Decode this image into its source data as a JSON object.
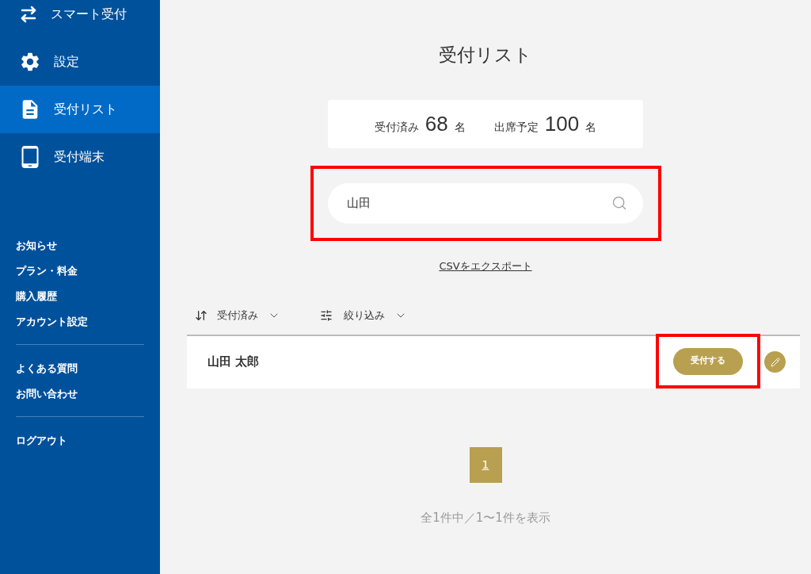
{
  "sidebar": {
    "nav_items": [
      {
        "label": "スマート受付",
        "selected": false
      },
      {
        "label": "設定",
        "selected": false
      },
      {
        "label": "受付リスト",
        "selected": true
      },
      {
        "label": "受付端末",
        "selected": false
      }
    ],
    "link_groups": [
      [
        "お知らせ",
        "プラン・料金",
        "購入履歴",
        "アカウント設定"
      ],
      [
        "よくある質問",
        "お問い合わせ"
      ],
      [
        "ログアウト"
      ]
    ]
  },
  "page": {
    "title": "受付リスト",
    "stats": [
      {
        "label": "受付済み",
        "value": "68",
        "unit": "名"
      },
      {
        "label": "出席予定",
        "value": "100",
        "unit": "名"
      }
    ],
    "search": {
      "value": "山田",
      "highlighted": true
    },
    "export_link": "CSVをエクスポート",
    "toolbar": [
      {
        "kind": "sort",
        "label": "受付済み"
      },
      {
        "kind": "filter",
        "label": "絞り込み"
      }
    ],
    "rows": [
      {
        "name": "山田 太郎",
        "action": "受付する",
        "action_highlighted": true
      }
    ],
    "pagination": [
      {
        "label": "1",
        "selected": true
      }
    ],
    "summary": "全1件中／1〜1件を表示"
  }
}
